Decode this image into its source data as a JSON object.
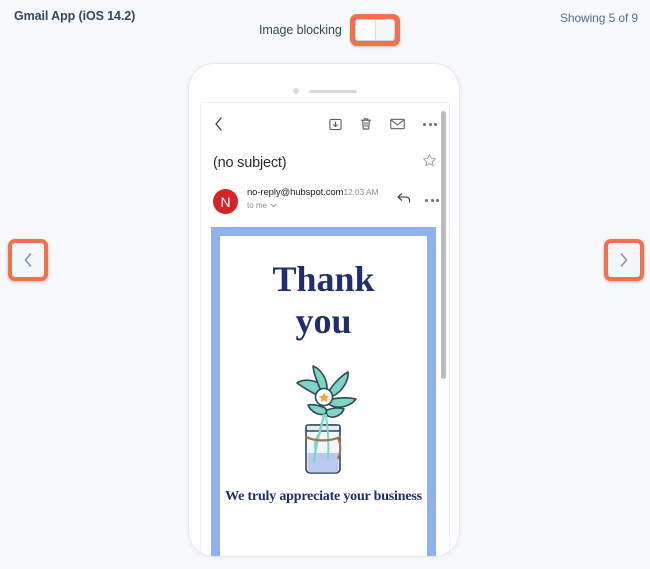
{
  "header": {
    "title": "Gmail App (iOS 14.2)",
    "toggle_label": "Image blocking",
    "toggle_state": "off",
    "showing_count": "Showing 5 of 9",
    "accent_color": "#f2714c",
    "title_color": "#33475b"
  },
  "nav": {
    "prev_icon": "chevron-left-icon",
    "next_icon": "chevron-right-icon"
  },
  "preview": {
    "device": "phone-mockup",
    "mail_toolbar": {
      "back_icon": "chevron-left-icon",
      "archive_icon": "archive-icon",
      "delete_icon": "trash-icon",
      "unread_icon": "envelope-icon",
      "overflow_icon": "more-horizontal-icon"
    },
    "subject": "(no subject)",
    "star_icon": "star-outline-icon",
    "sender": {
      "avatar_letter": "N",
      "avatar_color": "#d6232a",
      "email": "no-reply@hubspot.com",
      "time": "12:03 AM",
      "recipient": "to me",
      "reply_icon": "reply-icon",
      "overflow_icon": "more-horizontal-icon"
    },
    "email_body": {
      "frame_color": "#8fb2ef",
      "heading_line1": "Thank",
      "heading_line2": "you",
      "heading_color": "#212e6e",
      "illustration": "plant-in-mason-jar-illustration",
      "footer_text": "We truly appreciate your business"
    }
  }
}
